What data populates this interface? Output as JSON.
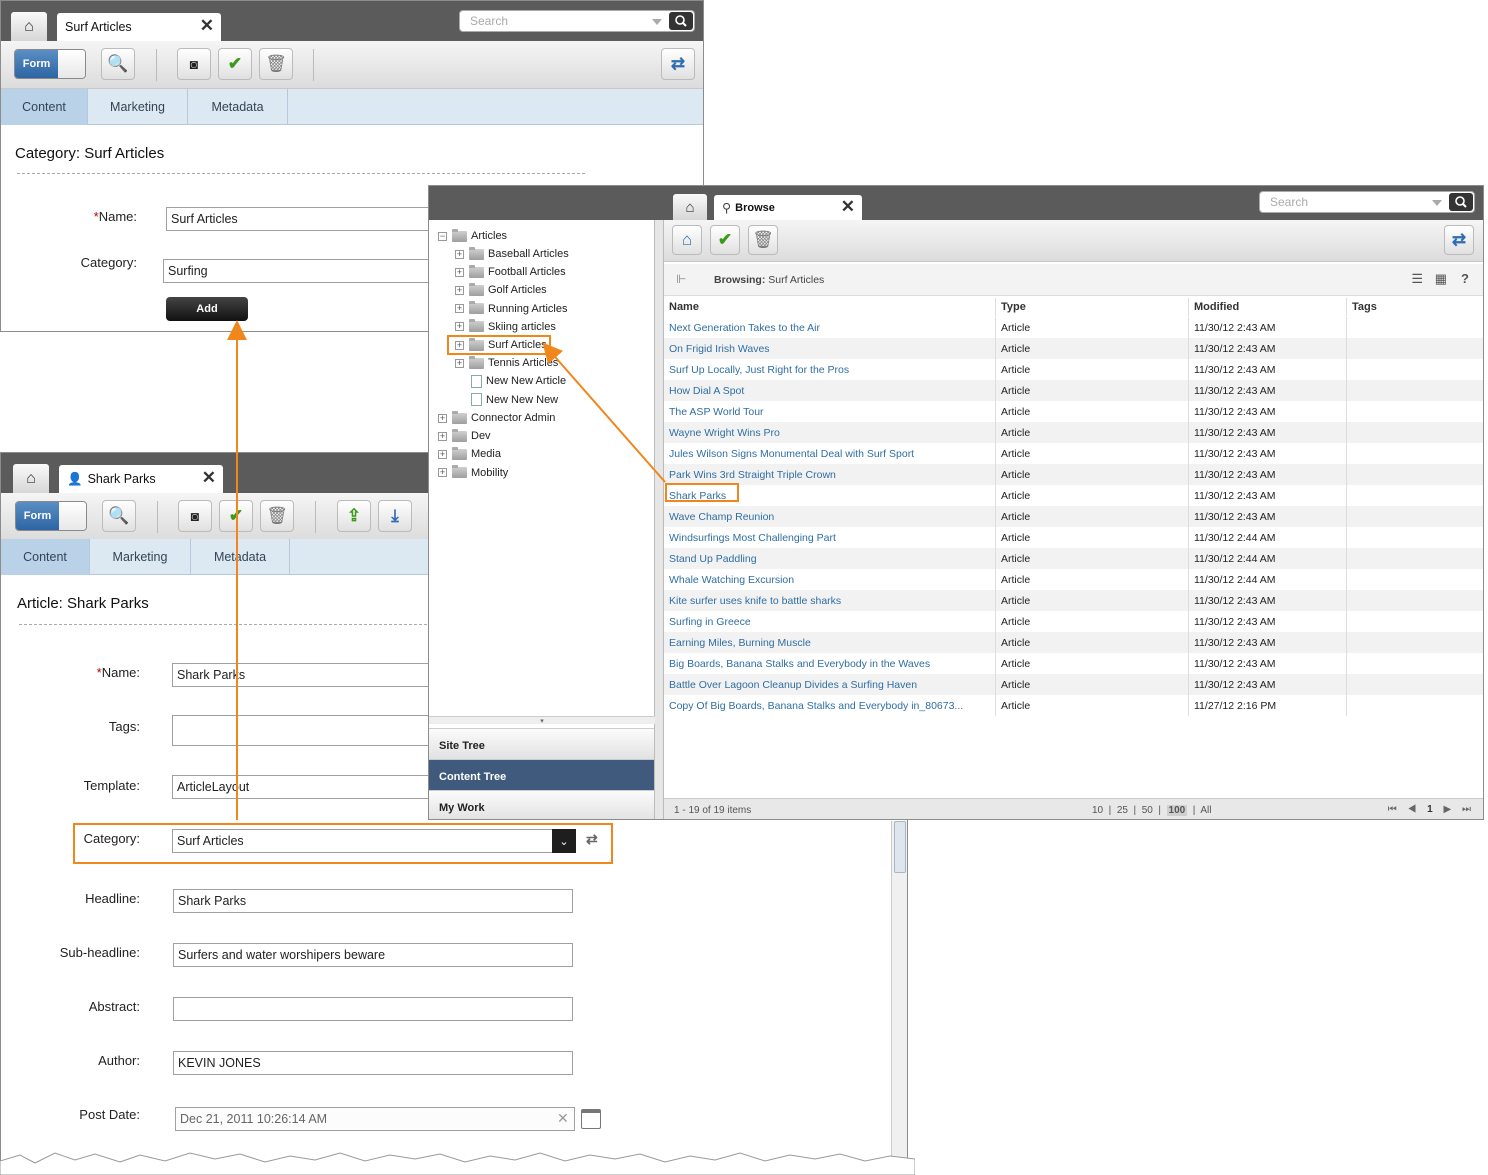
{
  "window_category": {
    "tab_title": "Surf Articles",
    "search_placeholder": "Search",
    "toolbar": {
      "form_label": "Form"
    },
    "subtabs": [
      "Content",
      "Marketing",
      "Metadata"
    ],
    "section_title": "Category:  Surf Articles",
    "fields": {
      "name_label": "Name:",
      "name_value": "Surf Articles",
      "category_label": "Category:",
      "category_value": "Surfing",
      "add_label": "Add"
    }
  },
  "window_browse": {
    "tab_title": "Browse",
    "search_placeholder": "Search",
    "tree": {
      "root": "Articles",
      "children": [
        "Baseball Articles",
        "Football Articles",
        "Golf Articles",
        "Running Articles",
        "Skiing articles",
        "Surf Articles",
        "Tennis Articles",
        "New New Article",
        "New New New"
      ],
      "other_roots": [
        "Connector Admin",
        "Dev",
        "Media",
        "Mobility"
      ]
    },
    "nav_buttons": [
      "Site Tree",
      "Content Tree",
      "My Work"
    ],
    "browsing_label": "Browsing:",
    "browsing_value": "Surf Articles",
    "columns": [
      "Name",
      "Type",
      "Modified",
      "Tags"
    ],
    "rows": [
      {
        "name": "Next Generation Takes to the Air",
        "type": "Article",
        "modified": "11/30/12 2:43 AM"
      },
      {
        "name": "On Frigid Irish Waves",
        "type": "Article",
        "modified": "11/30/12 2:43 AM"
      },
      {
        "name": "Surf Up Locally, Just Right for the Pros",
        "type": "Article",
        "modified": "11/30/12 2:43 AM"
      },
      {
        "name": "How Dial A Spot",
        "type": "Article",
        "modified": "11/30/12 2:43 AM"
      },
      {
        "name": "The ASP World Tour",
        "type": "Article",
        "modified": "11/30/12 2:43 AM"
      },
      {
        "name": "Wayne Wright Wins Pro",
        "type": "Article",
        "modified": "11/30/12 2:43 AM"
      },
      {
        "name": "Jules Wilson Signs Monumental Deal with Surf Sport",
        "type": "Article",
        "modified": "11/30/12 2:43 AM"
      },
      {
        "name": "Park Wins 3rd Straight Triple Crown",
        "type": "Article",
        "modified": "11/30/12 2:43 AM"
      },
      {
        "name": "Shark Parks",
        "type": "Article",
        "modified": "11/30/12 2:43 AM"
      },
      {
        "name": "Wave Champ Reunion",
        "type": "Article",
        "modified": "11/30/12 2:43 AM"
      },
      {
        "name": "Windsurfings Most Challenging Part",
        "type": "Article",
        "modified": "11/30/12 2:44 AM"
      },
      {
        "name": "Stand Up Paddling",
        "type": "Article",
        "modified": "11/30/12 2:44 AM"
      },
      {
        "name": "Whale Watching Excursion",
        "type": "Article",
        "modified": "11/30/12 2:44 AM"
      },
      {
        "name": "Kite surfer uses knife to battle sharks",
        "type": "Article",
        "modified": "11/30/12 2:43 AM"
      },
      {
        "name": "Surfing in Greece",
        "type": "Article",
        "modified": "11/30/12 2:43 AM"
      },
      {
        "name": "Earning Miles, Burning Muscle",
        "type": "Article",
        "modified": "11/30/12 2:43 AM"
      },
      {
        "name": "Big Boards, Banana Stalks and Everybody in the Waves",
        "type": "Article",
        "modified": "11/30/12 2:43 AM"
      },
      {
        "name": "Battle Over Lagoon Cleanup Divides a Surfing Haven",
        "type": "Article",
        "modified": "11/30/12 2:43 AM"
      },
      {
        "name": "Copy Of Big Boards, Banana Stalks and Everybody in_80673...",
        "type": "Article",
        "modified": "11/27/12 2:16 PM"
      }
    ],
    "pager": {
      "summary": "1 - 19 of 19 items",
      "sizes": [
        "10",
        "25",
        "50",
        "100",
        "All"
      ],
      "page": "1"
    }
  },
  "window_article": {
    "tab_title": "Shark Parks",
    "toolbar": {
      "form_label": "Form"
    },
    "subtabs": [
      "Content",
      "Marketing",
      "Metadata"
    ],
    "section_title": "Article: Shark Parks",
    "fields": {
      "name_label": "Name:",
      "name_value": "Shark Parks",
      "tags_label": "Tags:",
      "tags_value": "",
      "template_label": "Template:",
      "template_value": "ArticleLayout",
      "category_label": "Category:",
      "category_value": "Surf Articles",
      "headline_label": "Headline:",
      "headline_value": "Shark Parks",
      "subheadline_label": "Sub-headline:",
      "subheadline_value": "Surfers and water worshipers beware",
      "abstract_label": "Abstract:",
      "abstract_value": "",
      "author_label": "Author:",
      "author_value": "KEVIN JONES",
      "postdate_label": "Post Date:",
      "postdate_value": "Dec 21, 2011 10:26:14 AM"
    }
  },
  "colors": {
    "highlight": "#f0861c",
    "link": "#2f6ea3",
    "nav_selected": "#3f5a7c",
    "form_toggle": "#2d64a3"
  }
}
